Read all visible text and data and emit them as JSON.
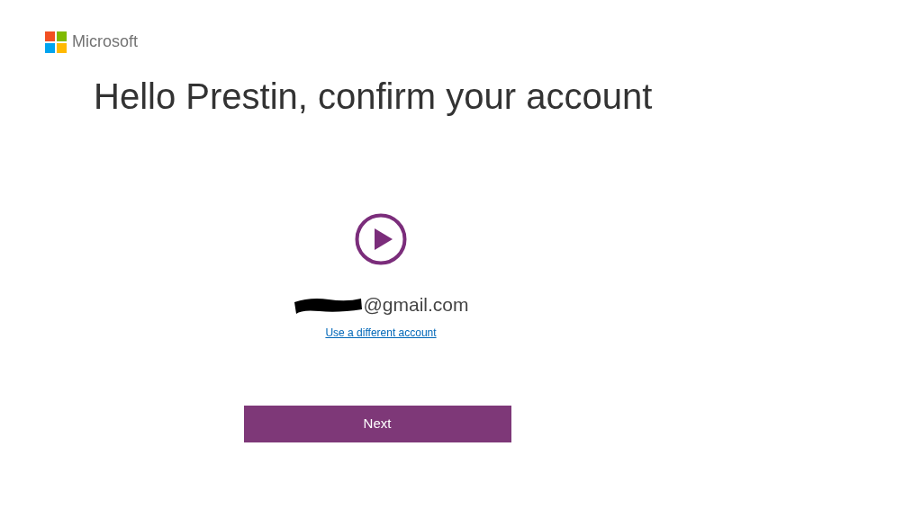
{
  "brand": {
    "name": "Microsoft"
  },
  "heading": "Hello Prestin, confirm your account",
  "account": {
    "email_visible_part": "@gmail.com",
    "link": "Use a different account"
  },
  "buttons": [
    "Next"
  ]
}
